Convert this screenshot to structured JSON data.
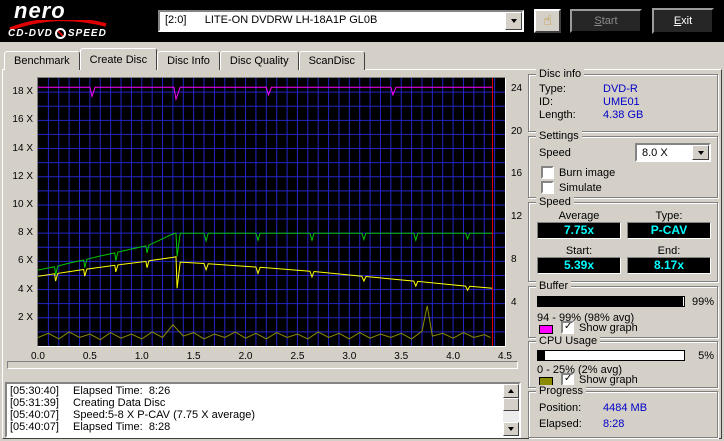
{
  "header": {
    "logo": {
      "brand": "nero",
      "product_left": "CD-DVD",
      "product_right": "SPEED"
    },
    "drive": "[2:0]      LITE-ON DVDRW LH-18A1P GL0B",
    "start_label": "Start",
    "exit_label": "Exit"
  },
  "tabs": {
    "active": "Create Disc",
    "items": [
      {
        "label": "Benchmark"
      },
      {
        "label": "Create Disc"
      },
      {
        "label": "Disc Info"
      },
      {
        "label": "Disc Quality"
      },
      {
        "label": "ScanDisc"
      }
    ]
  },
  "chart_data": {
    "type": "line",
    "x_range": [
      0,
      4.5
    ],
    "left_range": [
      0,
      19
    ],
    "right_range": [
      0,
      25
    ],
    "grid_x_step": 0.1,
    "grid_y_step": 1,
    "grid_color": "#2424c8",
    "bg_color": "#000000",
    "left_ticks": [
      "18 X",
      "16 X",
      "14 X",
      "12 X",
      "10 X",
      "8 X",
      "6 X",
      "4 X",
      "2 X"
    ],
    "right_ticks": [
      "24",
      "20",
      "16",
      "12",
      "8",
      "4"
    ],
    "x_ticks": [
      "0.0",
      "0.5",
      "1.0",
      "1.5",
      "2.0",
      "2.5",
      "3.0",
      "3.5",
      "4.0",
      "4.5"
    ],
    "end_marker_x": 4.38,
    "end_marker_color": "#dd0000",
    "series": [
      {
        "name": "buffer-level",
        "color": "#ff00ff",
        "points": [
          [
            0,
            18.35
          ],
          [
            0.5,
            18.35
          ],
          [
            0.52,
            17.7
          ],
          [
            0.55,
            18.35
          ],
          [
            1.31,
            18.35
          ],
          [
            1.33,
            17.5
          ],
          [
            1.37,
            18.35
          ],
          [
            2.2,
            18.35
          ],
          [
            2.22,
            17.8
          ],
          [
            2.25,
            18.35
          ],
          [
            3.4,
            18.35
          ],
          [
            3.42,
            17.8
          ],
          [
            3.45,
            18.35
          ],
          [
            4.38,
            18.35
          ]
        ]
      },
      {
        "name": "cpu-usage",
        "color": "#8b8b00",
        "points": [
          [
            0,
            0.6
          ],
          [
            0.1,
            0.9
          ],
          [
            0.2,
            0.5
          ],
          [
            0.3,
            1.0
          ],
          [
            0.4,
            0.6
          ],
          [
            0.5,
            0.85
          ],
          [
            0.6,
            0.45
          ],
          [
            0.7,
            0.95
          ],
          [
            0.8,
            0.55
          ],
          [
            0.9,
            0.85
          ],
          [
            1.0,
            0.5
          ],
          [
            1.1,
            1.0
          ],
          [
            1.2,
            0.6
          ],
          [
            1.3,
            1.5
          ],
          [
            1.4,
            0.7
          ],
          [
            1.5,
            0.95
          ],
          [
            1.6,
            0.5
          ],
          [
            1.7,
            0.85
          ],
          [
            1.8,
            0.6
          ],
          [
            1.9,
            1.0
          ],
          [
            2.0,
            0.55
          ],
          [
            2.1,
            0.9
          ],
          [
            2.2,
            0.5
          ],
          [
            2.3,
            0.95
          ],
          [
            2.4,
            0.6
          ],
          [
            2.5,
            0.85
          ],
          [
            2.6,
            0.5
          ],
          [
            2.7,
            1.0
          ],
          [
            2.8,
            0.6
          ],
          [
            2.9,
            0.9
          ],
          [
            3.0,
            0.5
          ],
          [
            3.1,
            0.95
          ],
          [
            3.2,
            0.55
          ],
          [
            3.3,
            0.85
          ],
          [
            3.4,
            0.6
          ],
          [
            3.5,
            0.9
          ],
          [
            3.6,
            0.5
          ],
          [
            3.7,
            1.05
          ],
          [
            3.75,
            2.85
          ],
          [
            3.8,
            0.7
          ],
          [
            3.9,
            0.9
          ],
          [
            4.0,
            0.55
          ],
          [
            4.1,
            0.95
          ],
          [
            4.2,
            0.6
          ],
          [
            4.3,
            0.8
          ],
          [
            4.36,
            0.6
          ]
        ]
      },
      {
        "name": "rotation-speed",
        "color": "#ffff00",
        "points": [
          [
            0,
            4.95
          ],
          [
            0.16,
            5.12
          ],
          [
            0.17,
            4.6
          ],
          [
            0.19,
            5.15
          ],
          [
            0.44,
            5.42
          ],
          [
            0.45,
            4.95
          ],
          [
            0.47,
            5.45
          ],
          [
            0.74,
            5.72
          ],
          [
            0.75,
            5.25
          ],
          [
            0.77,
            5.75
          ],
          [
            1.04,
            6.0
          ],
          [
            1.05,
            5.55
          ],
          [
            1.07,
            6.05
          ],
          [
            1.3,
            6.28
          ],
          [
            1.33,
            6.33
          ],
          [
            1.34,
            4.1
          ],
          [
            1.37,
            5.95
          ],
          [
            1.6,
            5.85
          ],
          [
            1.62,
            5.4
          ],
          [
            1.64,
            5.83
          ],
          [
            2.1,
            5.6
          ],
          [
            2.12,
            5.15
          ],
          [
            2.14,
            5.58
          ],
          [
            2.62,
            5.3
          ],
          [
            2.64,
            4.9
          ],
          [
            2.66,
            5.28
          ],
          [
            3.12,
            4.95
          ],
          [
            3.14,
            4.6
          ],
          [
            3.16,
            4.93
          ],
          [
            3.62,
            4.6
          ],
          [
            3.64,
            4.25
          ],
          [
            3.66,
            4.58
          ],
          [
            4.12,
            4.25
          ],
          [
            4.14,
            3.95
          ],
          [
            4.16,
            4.23
          ],
          [
            4.38,
            4.1
          ]
        ]
      },
      {
        "name": "write-speed",
        "color": "#00c400",
        "points": [
          [
            0,
            5.39
          ],
          [
            0.08,
            5.5
          ],
          [
            0.16,
            5.62
          ],
          [
            0.17,
            5.05
          ],
          [
            0.19,
            5.66
          ],
          [
            0.3,
            5.88
          ],
          [
            0.44,
            6.1
          ],
          [
            0.45,
            5.55
          ],
          [
            0.47,
            6.15
          ],
          [
            0.6,
            6.38
          ],
          [
            0.74,
            6.6
          ],
          [
            0.75,
            6.05
          ],
          [
            0.77,
            6.65
          ],
          [
            0.9,
            6.88
          ],
          [
            1.04,
            7.1
          ],
          [
            1.05,
            6.6
          ],
          [
            1.07,
            7.15
          ],
          [
            1.2,
            7.6
          ],
          [
            1.3,
            7.95
          ],
          [
            1.33,
            8.0
          ],
          [
            1.34,
            6.35
          ],
          [
            1.37,
            8.0
          ],
          [
            1.6,
            8.0
          ],
          [
            1.62,
            7.45
          ],
          [
            1.64,
            8.0
          ],
          [
            2.1,
            8.0
          ],
          [
            2.12,
            7.5
          ],
          [
            2.14,
            8.0
          ],
          [
            2.62,
            8.0
          ],
          [
            2.64,
            7.5
          ],
          [
            2.66,
            8.0
          ],
          [
            3.12,
            8.0
          ],
          [
            3.14,
            7.55
          ],
          [
            3.16,
            8.0
          ],
          [
            3.62,
            8.0
          ],
          [
            3.64,
            7.5
          ],
          [
            3.66,
            8.0
          ],
          [
            4.12,
            8.0
          ],
          [
            4.14,
            7.6
          ],
          [
            4.16,
            8.0
          ],
          [
            4.38,
            8.0
          ]
        ]
      }
    ]
  },
  "panels": {
    "disc_info": {
      "title": "Disc info",
      "rows": [
        {
          "label": "Type:",
          "value": "DVD-R"
        },
        {
          "label": "ID:",
          "value": "UME01"
        },
        {
          "label": "Length:",
          "value": "4.38 GB"
        }
      ]
    },
    "settings": {
      "title": "Settings",
      "speed_label": "Speed",
      "speed_value": "8.0 X",
      "burn_image": {
        "label": "Burn image",
        "checked": false
      },
      "simulate": {
        "label": "Simulate",
        "checked": false
      }
    },
    "speed": {
      "title": "Speed",
      "average_label": "Average",
      "average_value": "7.75x",
      "type_label": "Type:",
      "type_value": "P-CAV",
      "start_label": "Start:",
      "start_value": "5.39x",
      "end_label": "End:",
      "end_value": "8.17x"
    },
    "buffer": {
      "title": "Buffer",
      "fill": 0.99,
      "percent": "99%",
      "range": "94 - 99% (98% avg)",
      "swatch_color": "#ff00ff",
      "show_graph": {
        "label": "Show graph",
        "checked": true
      }
    },
    "cpu": {
      "title": "CPU Usage",
      "fill": 0.05,
      "percent": "5%",
      "range": "0 - 25% (2% avg)",
      "swatch_color": "#8b8b00",
      "show_graph": {
        "label": "Show graph",
        "checked": true
      }
    },
    "progress": {
      "title": "Progress",
      "position_label": "Position:",
      "position_value": "4484 MB",
      "elapsed_label": "Elapsed:",
      "elapsed_value": "8:28"
    }
  },
  "log": {
    "lines": [
      {
        "time": "[05:30:40]",
        "msg": "Elapsed Time:  8:26"
      },
      {
        "time": "[05:31:39]",
        "msg": "Creating Data Disc"
      },
      {
        "time": "[05:40:07]",
        "msg": "Speed:5-8 X P-CAV (7.75 X average)"
      },
      {
        "time": "[05:40:07]",
        "msg": "Elapsed Time:  8:28"
      }
    ]
  }
}
